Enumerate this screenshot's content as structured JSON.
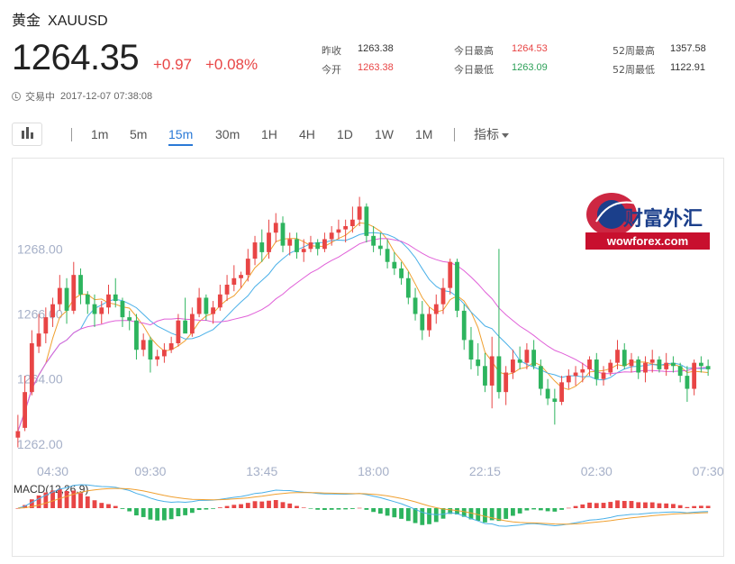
{
  "header": {
    "name": "黄金",
    "symbol": "XAUUSD"
  },
  "quote": {
    "price": "1264.35",
    "change": "+0.97",
    "change_pct": "+0.08%"
  },
  "status": {
    "label": "交易中",
    "time": "2017-12-07 07:38:08"
  },
  "stats": {
    "prev_close_label": "昨收",
    "prev_close": "1263.38",
    "open_label": "今开",
    "open": "1263.38",
    "day_high_label": "今日最高",
    "day_high": "1264.53",
    "day_low_label": "今日最低",
    "day_low": "1263.09",
    "wk52_high_label": "52周最高",
    "wk52_high": "1357.58",
    "wk52_low_label": "52周最低",
    "wk52_low": "1122.91"
  },
  "toolbar": {
    "timeframes": [
      "1m",
      "5m",
      "15m",
      "30m",
      "1H",
      "4H",
      "1D",
      "1W",
      "1M"
    ],
    "active": "15m",
    "indicators_label": "指标"
  },
  "colors": {
    "up": "#e84545",
    "down": "#2db45e",
    "ma1": "#f0a030",
    "ma2": "#4ab0e8",
    "ma3": "#e060d8",
    "axis_text": "#a6b0c8",
    "accent": "#2a79d6"
  },
  "watermark": {
    "text": "财富外汇",
    "domain": "wowforex.com"
  },
  "chart_data": {
    "type": "candlestick",
    "interval": "15m",
    "ylim": [
      1261.5,
      1270.5
    ],
    "yticks": [
      1262.0,
      1264.0,
      1266.0,
      1268.0
    ],
    "ytick_labels": [
      "1262.00",
      "1264.00",
      "1266.00",
      "1268.00"
    ],
    "xtick_labels": [
      "04:30",
      "09:30",
      "13:45",
      "18:00",
      "22:15",
      "02:30",
      "07:30"
    ],
    "xtick_index": [
      5,
      19,
      35,
      51,
      67,
      83,
      99
    ],
    "moving_average_colors": [
      "#f0a030",
      "#4ab0e8",
      "#e060d8"
    ],
    "macd_label": "MACD(12,26,9)",
    "candles": [
      [
        1262.2,
        1262.9,
        1261.9,
        1262.4
      ],
      [
        1262.5,
        1264.1,
        1262.4,
        1263.6
      ],
      [
        1263.6,
        1265.5,
        1263.5,
        1265.1
      ],
      [
        1265.0,
        1266.0,
        1264.8,
        1265.4
      ],
      [
        1265.4,
        1266.2,
        1265.1,
        1265.9
      ],
      [
        1265.9,
        1266.5,
        1265.6,
        1266.3
      ],
      [
        1266.3,
        1267.2,
        1266.1,
        1266.8
      ],
      [
        1266.8,
        1267.1,
        1265.7,
        1266.1
      ],
      [
        1266.1,
        1267.6,
        1266.0,
        1267.2
      ],
      [
        1267.2,
        1267.4,
        1266.3,
        1266.6
      ],
      [
        1266.6,
        1266.7,
        1266.0,
        1266.3
      ],
      [
        1266.3,
        1266.6,
        1265.6,
        1266.0
      ],
      [
        1266.0,
        1266.4,
        1265.7,
        1266.2
      ],
      [
        1266.2,
        1266.9,
        1266.0,
        1266.6
      ],
      [
        1266.6,
        1267.1,
        1266.2,
        1266.4
      ],
      [
        1266.4,
        1266.5,
        1265.6,
        1265.9
      ],
      [
        1265.9,
        1266.1,
        1265.5,
        1265.8
      ],
      [
        1265.8,
        1266.0,
        1264.6,
        1264.9
      ],
      [
        1264.9,
        1265.4,
        1264.7,
        1265.2
      ],
      [
        1265.2,
        1265.3,
        1264.2,
        1264.6
      ],
      [
        1264.6,
        1264.9,
        1264.4,
        1264.7
      ],
      [
        1264.7,
        1265.1,
        1264.5,
        1264.9
      ],
      [
        1264.9,
        1265.3,
        1264.8,
        1265.1
      ],
      [
        1265.1,
        1266.0,
        1265.0,
        1265.8
      ],
      [
        1265.8,
        1266.5,
        1265.6,
        1265.4
      ],
      [
        1265.4,
        1266.2,
        1265.3,
        1266.0
      ],
      [
        1266.0,
        1266.8,
        1265.9,
        1266.5
      ],
      [
        1266.5,
        1266.6,
        1265.8,
        1266.0
      ],
      [
        1266.0,
        1266.4,
        1265.7,
        1266.2
      ],
      [
        1266.2,
        1266.9,
        1266.1,
        1266.6
      ],
      [
        1266.6,
        1267.2,
        1266.4,
        1266.9
      ],
      [
        1266.9,
        1267.5,
        1266.7,
        1267.1
      ],
      [
        1267.1,
        1267.3,
        1266.8,
        1267.2
      ],
      [
        1267.2,
        1268.0,
        1267.0,
        1267.7
      ],
      [
        1267.7,
        1268.4,
        1267.5,
        1268.2
      ],
      [
        1268.2,
        1268.6,
        1267.6,
        1267.9
      ],
      [
        1267.9,
        1268.9,
        1267.7,
        1268.5
      ],
      [
        1268.5,
        1269.1,
        1268.2,
        1268.8
      ],
      [
        1268.8,
        1269.0,
        1267.9,
        1268.1
      ],
      [
        1268.1,
        1268.5,
        1267.8,
        1268.3
      ],
      [
        1268.3,
        1268.5,
        1267.7,
        1267.9
      ],
      [
        1267.9,
        1268.3,
        1267.6,
        1268.0
      ],
      [
        1268.0,
        1268.4,
        1267.9,
        1268.2
      ],
      [
        1268.2,
        1268.3,
        1267.8,
        1268.0
      ],
      [
        1268.0,
        1268.5,
        1267.9,
        1268.3
      ],
      [
        1268.3,
        1268.7,
        1268.1,
        1268.5
      ],
      [
        1268.5,
        1268.9,
        1268.3,
        1268.6
      ],
      [
        1268.6,
        1268.9,
        1268.2,
        1268.7
      ],
      [
        1268.7,
        1269.3,
        1268.5,
        1268.9
      ],
      [
        1268.9,
        1269.6,
        1268.7,
        1269.3
      ],
      [
        1269.3,
        1269.4,
        1268.2,
        1268.4
      ],
      [
        1268.4,
        1268.7,
        1267.9,
        1268.1
      ],
      [
        1268.1,
        1268.5,
        1267.8,
        1268.0
      ],
      [
        1268.0,
        1268.3,
        1267.4,
        1267.6
      ],
      [
        1267.6,
        1267.9,
        1267.2,
        1267.4
      ],
      [
        1267.4,
        1267.6,
        1266.9,
        1267.1
      ],
      [
        1267.1,
        1267.3,
        1266.3,
        1266.5
      ],
      [
        1266.5,
        1266.8,
        1265.8,
        1266.0
      ],
      [
        1266.0,
        1266.4,
        1265.2,
        1265.5
      ],
      [
        1265.5,
        1266.2,
        1265.3,
        1266.0
      ],
      [
        1266.0,
        1266.6,
        1265.7,
        1266.3
      ],
      [
        1266.3,
        1267.1,
        1266.0,
        1266.8
      ],
      [
        1266.8,
        1267.7,
        1266.6,
        1267.6
      ],
      [
        1267.6,
        1267.7,
        1265.9,
        1266.1
      ],
      [
        1266.1,
        1266.3,
        1264.9,
        1265.2
      ],
      [
        1265.2,
        1265.6,
        1264.3,
        1264.6
      ],
      [
        1264.6,
        1265.1,
        1264.1,
        1264.4
      ],
      [
        1264.4,
        1264.8,
        1263.6,
        1263.8
      ],
      [
        1263.8,
        1265.3,
        1263.1,
        1264.7
      ],
      [
        1264.7,
        1268.0,
        1263.4,
        1263.6
      ],
      [
        1263.6,
        1264.4,
        1263.2,
        1264.2
      ],
      [
        1264.2,
        1264.9,
        1264.0,
        1264.6
      ],
      [
        1264.6,
        1265.0,
        1264.3,
        1264.5
      ],
      [
        1264.5,
        1265.1,
        1264.3,
        1264.9
      ],
      [
        1264.9,
        1265.2,
        1264.3,
        1264.4
      ],
      [
        1264.4,
        1264.6,
        1263.5,
        1263.7
      ],
      [
        1263.7,
        1264.0,
        1263.2,
        1263.4
      ],
      [
        1263.4,
        1263.7,
        1262.6,
        1263.3
      ],
      [
        1263.3,
        1264.1,
        1263.2,
        1263.9
      ],
      [
        1263.9,
        1264.3,
        1263.7,
        1264.1
      ],
      [
        1264.1,
        1264.4,
        1263.8,
        1264.2
      ],
      [
        1264.2,
        1264.5,
        1263.9,
        1264.3
      ],
      [
        1264.3,
        1264.7,
        1264.1,
        1264.6
      ],
      [
        1264.6,
        1264.8,
        1263.8,
        1264.0
      ],
      [
        1264.0,
        1264.4,
        1263.8,
        1264.2
      ],
      [
        1264.2,
        1264.6,
        1264.1,
        1264.5
      ],
      [
        1264.5,
        1265.2,
        1264.3,
        1264.9
      ],
      [
        1264.9,
        1265.1,
        1264.3,
        1264.4
      ],
      [
        1264.4,
        1264.8,
        1264.2,
        1264.6
      ],
      [
        1264.6,
        1264.7,
        1264.0,
        1264.2
      ],
      [
        1264.2,
        1264.7,
        1263.9,
        1264.5
      ],
      [
        1264.5,
        1264.9,
        1264.2,
        1264.6
      ],
      [
        1264.6,
        1264.7,
        1264.2,
        1264.3
      ],
      [
        1264.3,
        1264.8,
        1264.1,
        1264.5
      ],
      [
        1264.5,
        1264.7,
        1264.2,
        1264.4
      ],
      [
        1264.4,
        1264.5,
        1263.9,
        1264.1
      ],
      [
        1264.1,
        1264.4,
        1263.3,
        1263.7
      ],
      [
        1263.7,
        1264.6,
        1263.5,
        1264.5
      ],
      [
        1264.5,
        1264.7,
        1264.2,
        1264.4
      ],
      [
        1264.4,
        1264.6,
        1264.1,
        1264.3
      ]
    ]
  }
}
